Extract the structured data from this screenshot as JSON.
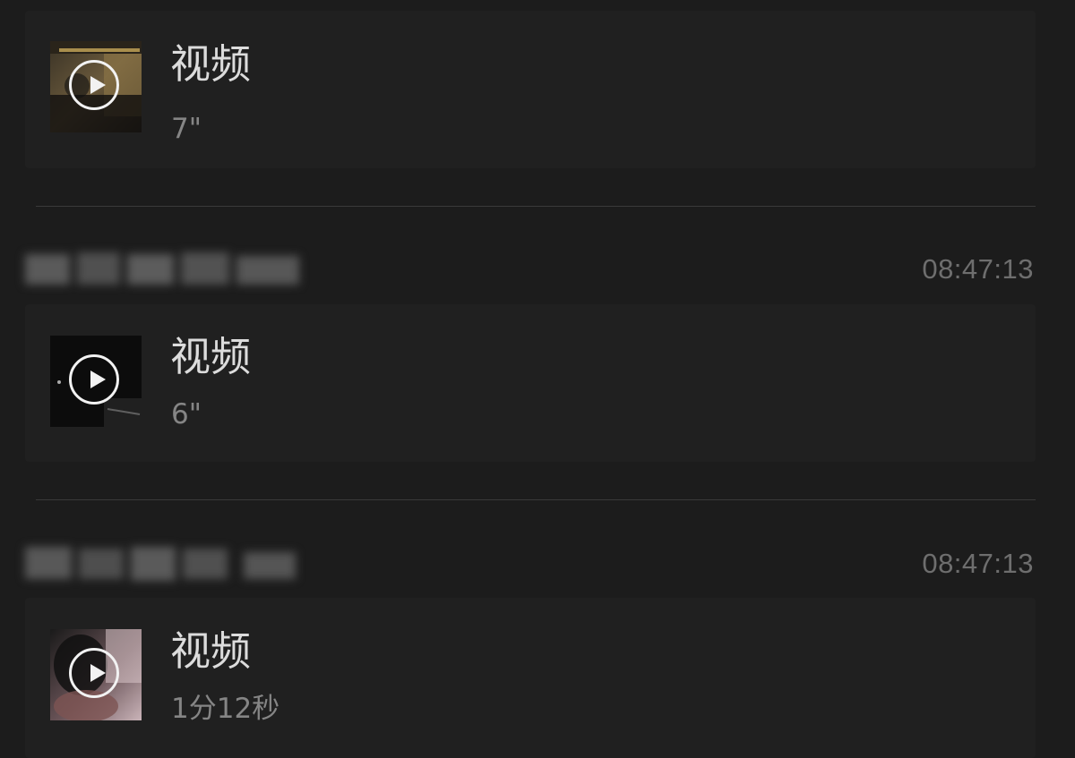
{
  "messages": [
    {
      "title": "视频",
      "duration": "7\""
    },
    {
      "time": "08:47:13",
      "title": "视频",
      "duration": "6\""
    },
    {
      "time": "08:47:13",
      "title": "视频",
      "duration": "1分12秒"
    }
  ],
  "icons": {
    "play": "play-circle-icon"
  },
  "colors": {
    "background": "#1c1c1c",
    "card": "#202020",
    "title": "#dcdcdc",
    "subtext": "#858585",
    "timestamp": "#6e6e6e"
  }
}
